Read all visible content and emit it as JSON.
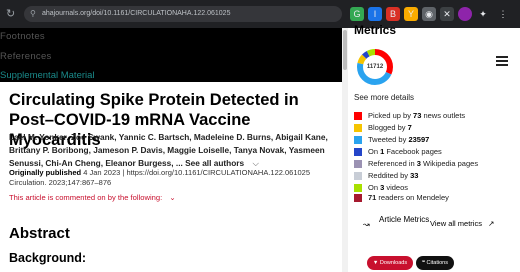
{
  "browser": {
    "url": "ahajournals.org/doi/10.1161/CIRCULATIONAHA.122.061025",
    "extensions": [
      "G",
      "I",
      "B",
      "Y",
      "◉",
      "✕",
      "⋮"
    ]
  },
  "article": {
    "nav_links": [
      "Footnotes",
      "References"
    ],
    "supplemental_label": "Supplemental Material",
    "title": "Circulating Spike Protein Detected in Post–COVID-19 mRNA Vaccine Myocarditis",
    "authors": "Lael M. Yonker, Zoe Swank, Yannic C. Bartsch, Madeleine D. Burns, Abigail Kane, Brittany P. Boribong, Jameson P. Davis, Maggie Loiselle, Tanya Novak, Yasmeen Senussi, Chi-An Cheng, Eleanor Burgess, ...",
    "see_all_label": "See all authors",
    "pub_prefix": "Originally published",
    "pub_date": "4 Jan 2023",
    "doi": "https://doi.org/10.1161/CIRCULATIONAHA.122.061025",
    "citation": "Circulation. 2023;147:867–876",
    "commented_label": "This article is commented on by the following:",
    "abstract_heading": "Abstract",
    "background_heading": "Background:"
  },
  "metrics": {
    "title": "Metrics",
    "score": "11712",
    "see_more": "See more details",
    "items": [
      {
        "pre": "Picked up by ",
        "count": "73",
        "post": " news outlets",
        "color": "#ff0000"
      },
      {
        "pre": "Blogged by ",
        "count": "7",
        "post": "",
        "color": "#f5c400"
      },
      {
        "pre": "Tweeted by ",
        "count": "23597",
        "post": "",
        "color": "#2aa3ef"
      },
      {
        "pre": "On ",
        "count": "1",
        "post": " Facebook pages",
        "color": "#2445c9"
      },
      {
        "pre": "Referenced in ",
        "count": "3",
        "post": " Wikipedia pages",
        "color": "#9b92b3"
      },
      {
        "pre": "Reddited by ",
        "count": "33",
        "post": "",
        "color": "#c8cdd6"
      },
      {
        "pre": "On ",
        "count": "3",
        "post": " videos",
        "color": "#a8e000"
      }
    ],
    "mendeley_count": "71",
    "mendeley_text": " readers on Mendeley",
    "article_metrics_label": "Article Metrics",
    "view_all_label": "View all metrics",
    "downloads_label": "Downloads",
    "citations_label": "Citations",
    "accent_red": "#c8102e"
  }
}
